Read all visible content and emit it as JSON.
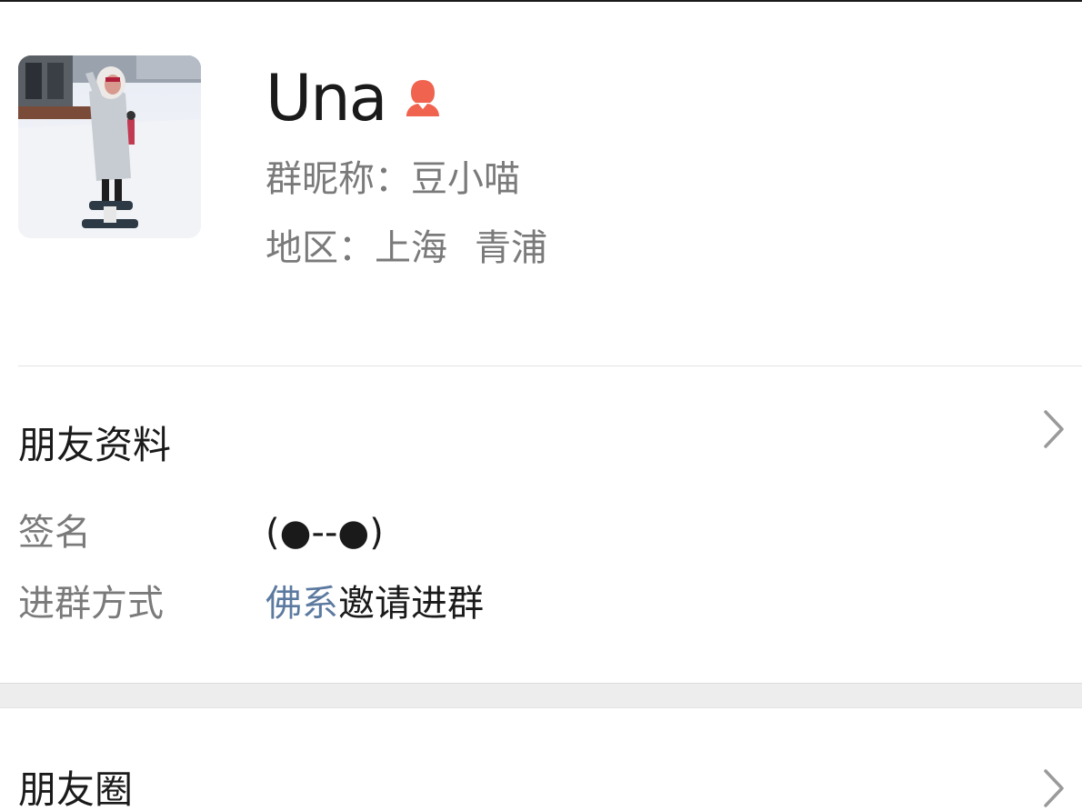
{
  "profile": {
    "name": "Una",
    "gender": "female",
    "gender_icon": "female-user-icon",
    "gender_color": "#f0634f",
    "group_nickname": "群昵称：豆小喵",
    "region_label": "地区：",
    "region_province": "上海",
    "region_city": "青浦"
  },
  "friend_info": {
    "title": "朋友资料",
    "signature_label": "签名",
    "signature_value": "(●--●)",
    "join_label": "进群方式",
    "join_inviter": "佛系",
    "join_suffix": "邀请进群"
  },
  "moments": {
    "title": "朋友圈"
  },
  "colors": {
    "link": "#5c7aa0",
    "secondary_text": "#7a7a7a",
    "primary_text": "#1a1a1a"
  }
}
